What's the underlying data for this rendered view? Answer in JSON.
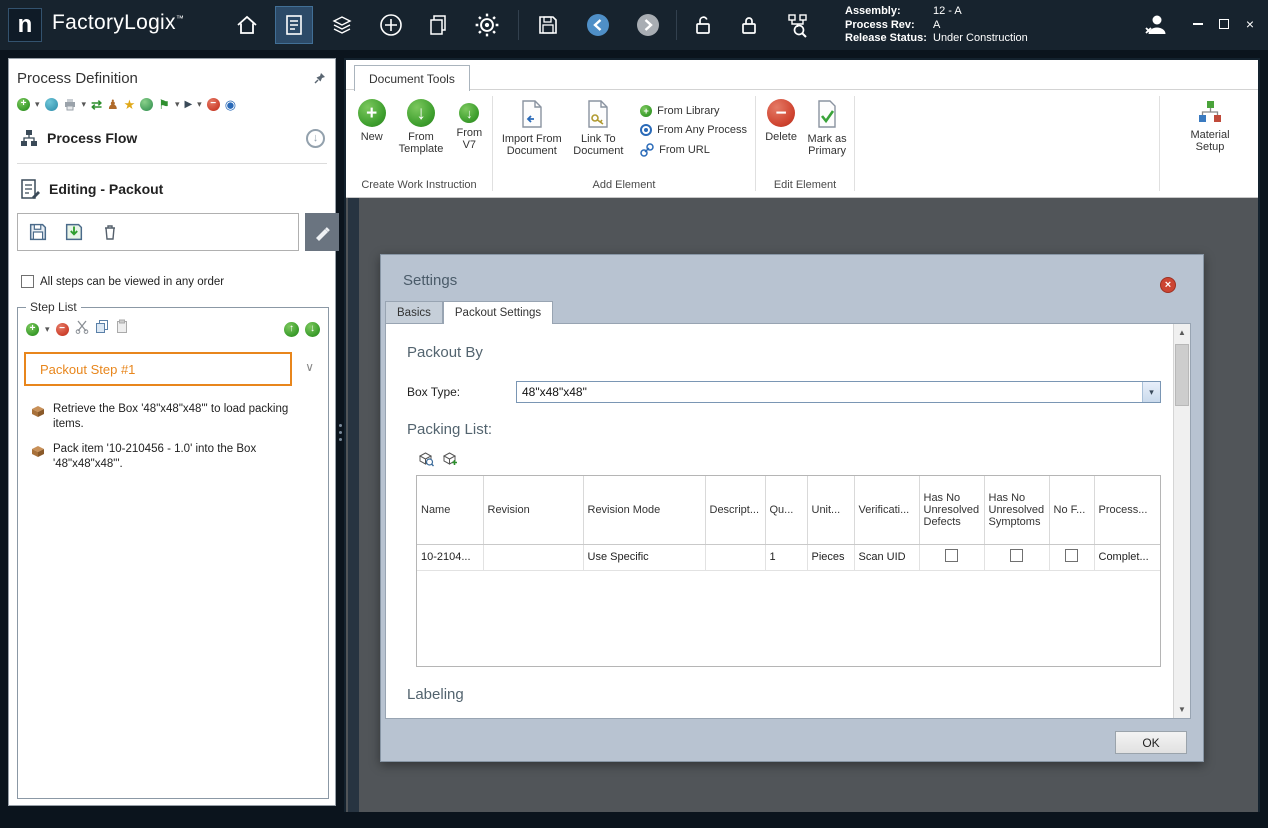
{
  "icons": {
    "plus": "+",
    "minus": "−",
    "close": "×",
    "caret": "▾",
    "chevron": "∨",
    "up": "↑",
    "down": "↓",
    "swap": "⇄",
    "person": "♟",
    "star": "★",
    "flag": "⚑",
    "play": "▶",
    "dot": "◉",
    "tri_up": "▲",
    "tri_down": "▼"
  },
  "titlebar": {
    "logo": "n",
    "app_name": "FactoryLogix",
    "trademark": "™",
    "assembly_label": "Assembly:",
    "assembly_value": "12 - A",
    "process_rev_label": "Process Rev:",
    "process_rev_value": "A",
    "release_status_label": "Release Status:",
    "release_status_value": "Under Construction"
  },
  "left_panel": {
    "title": "Process Definition",
    "process_flow": "Process Flow",
    "editing": "Editing - Packout",
    "order_checkbox": "All steps can be viewed in any order",
    "step_list": {
      "title": "Step List",
      "selected_step": "Packout Step #1",
      "items": [
        {
          "text": "Retrieve the Box '48\"x48\"x48\"' to load packing items."
        },
        {
          "text": "Pack item '10-210456 - 1.0' into the Box '48\"x48\"x48\"'."
        }
      ]
    }
  },
  "ribbon": {
    "tab": "Document Tools",
    "create_group": {
      "label": "Create Work Instruction",
      "new": "New",
      "from_template": "From Template",
      "from_v7": "From V7"
    },
    "add_group": {
      "label": "Add Element",
      "import_from_document": "Import From Document",
      "link_to_document": "Link To Document",
      "from_library": "From Library",
      "from_any_process": "From Any Process",
      "from_url": "From URL"
    },
    "edit_group": {
      "label": "Edit Element",
      "delete": "Delete",
      "mark_as_primary": "Mark as Primary"
    },
    "material_setup": "Material Setup"
  },
  "dialog": {
    "title": "Settings",
    "tabs": {
      "basics": "Basics",
      "packout": "Packout Settings"
    },
    "packout_by": "Packout By",
    "box_type_label": "Box Type:",
    "box_type_value": "48\"x48\"x48\"",
    "packing_list": "Packing List:",
    "table": {
      "columns": [
        "Name",
        "Revision",
        "Revision Mode",
        "Descript...",
        "Qu...",
        "Unit...",
        "Verificati...",
        "Has No Unresolved Defects",
        "Has No Unresolved Symptoms",
        "No F...",
        "Process..."
      ],
      "row": {
        "name": "10-2104...",
        "revision": "",
        "revision_mode": "Use Specific",
        "description": "",
        "quantity": "1",
        "units": "Pieces",
        "verification": "Scan UID",
        "process": "Complet..."
      }
    },
    "labeling": "Labeling",
    "ok": "OK"
  }
}
